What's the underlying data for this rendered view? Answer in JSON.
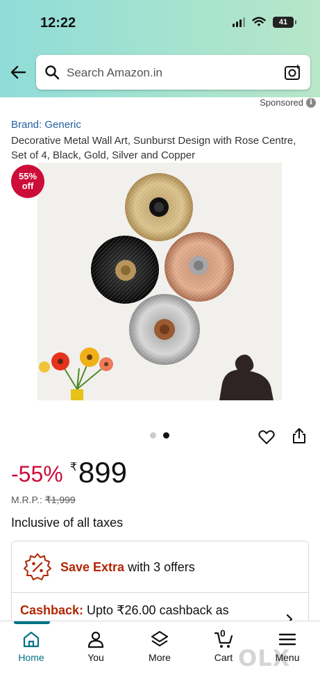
{
  "status_bar": {
    "time": "12:22",
    "battery": "41"
  },
  "search": {
    "placeholder": "Search Amazon.in"
  },
  "sponsored_label": "Sponsored",
  "product": {
    "brand": "Brand: Generic",
    "title": "Decorative Metal Wall Art, Sunburst Design with Rose Centre, Set of 4, Black, Gold, Silver and Copper",
    "discount_badge_pct": "55%",
    "discount_badge_off": "off",
    "image_count": 2,
    "active_image": 1
  },
  "pricing": {
    "discount": "-55%",
    "currency": "₹",
    "price": "899",
    "mrp_label": "M.R.P.:",
    "mrp_value": "₹1,999",
    "taxes": "Inclusive of all taxes"
  },
  "offers": {
    "save_extra": "Save Extra",
    "with_offers": " with 3 offers",
    "cashback_label": "Cashback:",
    "cashback_text": " Upto ₹26.00 cashback as"
  },
  "bottom_nav": {
    "items": [
      {
        "label": "Home",
        "icon": "home-icon",
        "active": true
      },
      {
        "label": "You",
        "icon": "user-icon"
      },
      {
        "label": "More",
        "icon": "layers-icon"
      },
      {
        "label": "Cart",
        "icon": "cart-icon",
        "count": "0"
      },
      {
        "label": "Menu",
        "icon": "menu-icon"
      }
    ]
  },
  "watermark": "OLX",
  "colors": {
    "accent": "#007185",
    "deal_red": "#cc0c39",
    "link_blue": "#2162a1"
  }
}
